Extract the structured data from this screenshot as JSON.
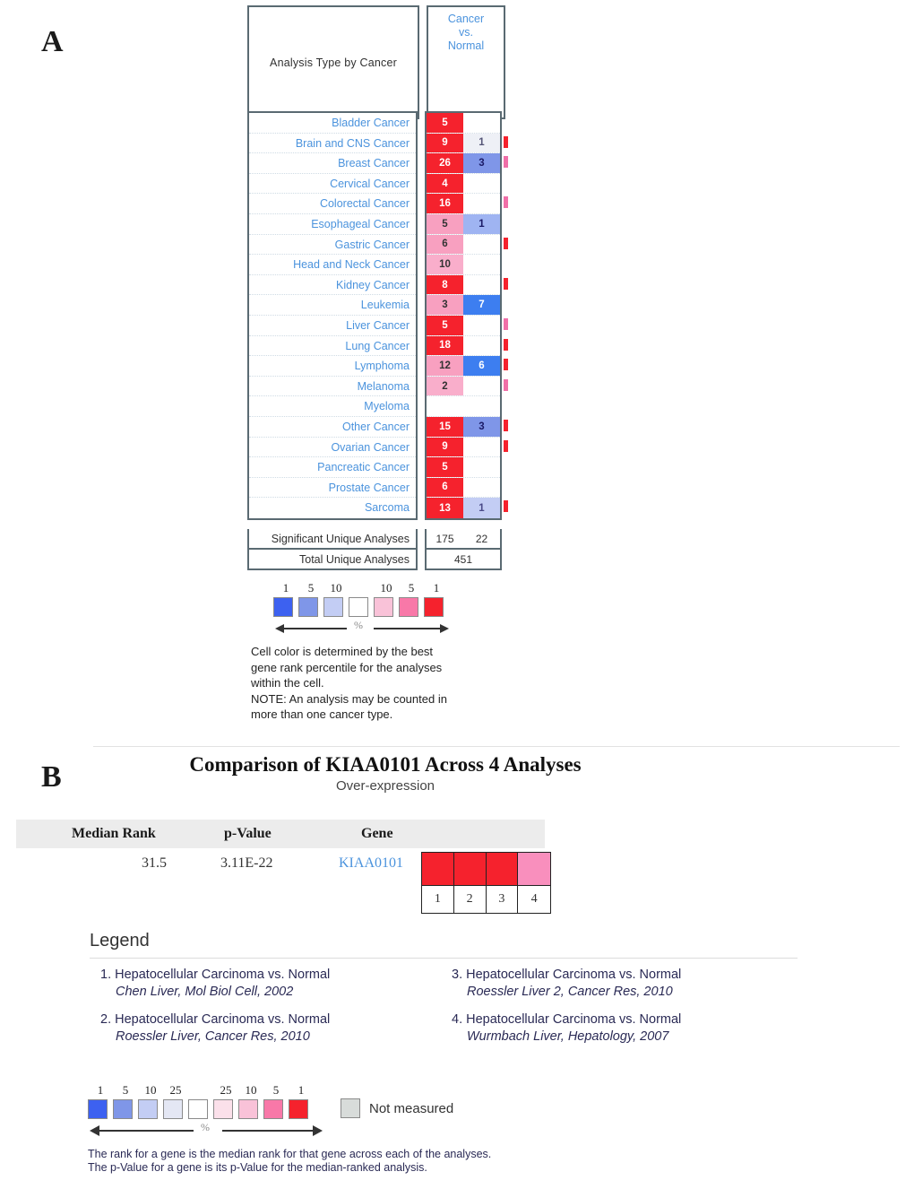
{
  "panels": {
    "a_letter": "A",
    "b_letter": "B"
  },
  "panelA": {
    "header": {
      "left": "Analysis Type by Cancer",
      "right_line1": "Cancer",
      "right_line2": "vs.",
      "right_line3": "Normal"
    },
    "rows": [
      {
        "name": "Bladder Cancer",
        "over": "5",
        "under": "",
        "over_color": "#f5222d",
        "over_text": "#ffffff",
        "under_color": "#ffffff",
        "under_text": "#333366",
        "strip_over": "",
        "strip_under": ""
      },
      {
        "name": "Brain and CNS Cancer",
        "over": "9",
        "under": "1",
        "over_color": "#f5222d",
        "over_text": "#ffffff",
        "under_color": "#eef0f6",
        "under_text": "#555577",
        "strip_over": "#f5222d",
        "strip_under": ""
      },
      {
        "name": "Breast Cancer",
        "over": "26",
        "under": "3",
        "over_color": "#f5222d",
        "over_text": "#ffffff",
        "under_color": "#7f96e8",
        "under_text": "#1a1a66",
        "strip_over": "#f06fa8",
        "strip_under": ""
      },
      {
        "name": "Cervical Cancer",
        "over": "4",
        "under": "",
        "over_color": "#f5222d",
        "over_text": "#ffffff",
        "under_color": "#ffffff",
        "under_text": "#333366",
        "strip_over": "",
        "strip_under": ""
      },
      {
        "name": "Colorectal Cancer",
        "over": "16",
        "under": "",
        "over_color": "#f5222d",
        "over_text": "#ffffff",
        "under_color": "#ffffff",
        "under_text": "#333366",
        "strip_over": "#f06fa8",
        "strip_under": ""
      },
      {
        "name": "Esophageal Cancer",
        "over": "5",
        "under": "1",
        "over_color": "#f8a0c0",
        "over_text": "#333333",
        "under_color": "#9fb4f2",
        "under_text": "#1a1a66",
        "strip_over": "",
        "strip_under": ""
      },
      {
        "name": "Gastric Cancer",
        "over": "6",
        "under": "",
        "over_color": "#f8a0c0",
        "over_text": "#333333",
        "under_color": "#ffffff",
        "under_text": "#333366",
        "strip_over": "#f5222d",
        "strip_under": ""
      },
      {
        "name": "Head and Neck Cancer",
        "over": "10",
        "under": "",
        "over_color": "#f9aecb",
        "over_text": "#333333",
        "under_color": "#ffffff",
        "under_text": "#333366",
        "strip_over": "",
        "strip_under": ""
      },
      {
        "name": "Kidney Cancer",
        "over": "8",
        "under": "",
        "over_color": "#f5222d",
        "over_text": "#ffffff",
        "under_color": "#ffffff",
        "under_text": "#333366",
        "strip_over": "#f5222d",
        "strip_under": ""
      },
      {
        "name": "Leukemia",
        "over": "3",
        "under": "7",
        "over_color": "#f8a0c0",
        "over_text": "#333333",
        "under_color": "#3d7ef0",
        "under_text": "#ffffff",
        "strip_over": "",
        "strip_under": ""
      },
      {
        "name": "Liver Cancer",
        "over": "5",
        "under": "",
        "over_color": "#f5222d",
        "over_text": "#ffffff",
        "under_color": "#ffffff",
        "under_text": "#333366",
        "strip_over": "#f06fa8",
        "strip_under": ""
      },
      {
        "name": "Lung Cancer",
        "over": "18",
        "under": "",
        "over_color": "#f5222d",
        "over_text": "#ffffff",
        "under_color": "#ffffff",
        "under_text": "#333366",
        "strip_over": "#f5222d",
        "strip_under": ""
      },
      {
        "name": "Lymphoma",
        "over": "12",
        "under": "6",
        "over_color": "#f8a0c0",
        "over_text": "#333333",
        "under_color": "#3d7ef0",
        "under_text": "#ffffff",
        "strip_over": "#f5222d",
        "strip_under": ""
      },
      {
        "name": "Melanoma",
        "over": "2",
        "under": "",
        "over_color": "#f9aecb",
        "over_text": "#333333",
        "under_color": "#ffffff",
        "under_text": "#333366",
        "strip_over": "#f06fa8",
        "strip_under": ""
      },
      {
        "name": "Myeloma",
        "over": "",
        "under": "",
        "over_color": "#ffffff",
        "over_text": "#333333",
        "under_color": "#ffffff",
        "under_text": "#333366",
        "strip_over": "",
        "strip_under": ""
      },
      {
        "name": "Other Cancer",
        "over": "15",
        "under": "3",
        "over_color": "#f5222d",
        "over_text": "#ffffff",
        "under_color": "#7f96e8",
        "under_text": "#1a1a66",
        "strip_over": "#f5222d",
        "strip_under": ""
      },
      {
        "name": "Ovarian Cancer",
        "over": "9",
        "under": "",
        "over_color": "#f5222d",
        "over_text": "#ffffff",
        "under_color": "#ffffff",
        "under_text": "#333366",
        "strip_over": "#f5222d",
        "strip_under": ""
      },
      {
        "name": "Pancreatic Cancer",
        "over": "5",
        "under": "",
        "over_color": "#f5222d",
        "over_text": "#ffffff",
        "under_color": "#ffffff",
        "under_text": "#333366",
        "strip_over": "",
        "strip_under": ""
      },
      {
        "name": "Prostate Cancer",
        "over": "6",
        "under": "",
        "over_color": "#f5222d",
        "over_text": "#ffffff",
        "under_color": "#ffffff",
        "under_text": "#333366",
        "strip_over": "",
        "strip_under": ""
      },
      {
        "name": "Sarcoma",
        "over": "13",
        "under": "1",
        "over_color": "#f5222d",
        "over_text": "#ffffff",
        "under_color": "#c3cdf4",
        "under_text": "#4a4a88",
        "strip_over": "#f5222d",
        "strip_under": ""
      }
    ],
    "summary": {
      "significant_label": "Significant Unique Analyses",
      "significant_over": "175",
      "significant_under": "22",
      "total_label": "Total Unique Analyses",
      "total_value": "451"
    },
    "legend": {
      "numbers": [
        "1",
        "5",
        "10",
        "",
        "10",
        "5",
        "1"
      ],
      "swatches": [
        "#3d61f0",
        "#7f96e8",
        "#c3cdf4",
        "#ffffff",
        "#f9c2d8",
        "#f878a8",
        "#f5222d"
      ],
      "percent_label": "%"
    },
    "caption": [
      "Cell color is determined by the best",
      "gene rank percentile for the analyses",
      "within the cell.",
      "NOTE: An analysis may be counted in",
      "more than one cancer type."
    ]
  },
  "panelB": {
    "title": "Comparison of KIAA0101 Across 4 Analyses",
    "subtitle": "Over-expression",
    "table": {
      "headers": {
        "rank": "Median Rank",
        "pvalue": "p-Value",
        "gene": "Gene"
      },
      "row": {
        "rank": "31.5",
        "pvalue": "3.11E-22",
        "gene": "KIAA0101"
      },
      "heat_colors": [
        "#f5222d",
        "#f5222d",
        "#f5222d",
        "#f98fbd"
      ],
      "heat_labels": [
        "1",
        "2",
        "3",
        "4"
      ]
    },
    "legend_title": "Legend",
    "legend_items": [
      {
        "num": "1.",
        "title": "Hepatocellular Carcinoma vs. Normal",
        "source": "Chen Liver, Mol Biol Cell, 2002"
      },
      {
        "num": "2.",
        "title": "Hepatocellular Carcinoma vs. Normal",
        "source": "Roessler Liver, Cancer Res, 2010"
      },
      {
        "num": "3.",
        "title": "Hepatocellular Carcinoma vs. Normal",
        "source": "Roessler Liver 2, Cancer Res, 2010"
      },
      {
        "num": "4.",
        "title": "Hepatocellular Carcinoma vs. Normal",
        "source": "Wurmbach Liver, Hepatology, 2007"
      }
    ],
    "scale": {
      "numbers": [
        "1",
        "5",
        "10",
        "25",
        "",
        "25",
        "10",
        "5",
        "1"
      ],
      "swatches": [
        "#3d61f0",
        "#7f96e8",
        "#c3cdf4",
        "#e4e7f4",
        "#ffffff",
        "#fbe0ea",
        "#f9c2d8",
        "#f878a8",
        "#f5222d"
      ],
      "percent_label": "%",
      "not_measured_label": "Not measured",
      "not_measured_color": "#d8dcda"
    },
    "footer": [
      "The rank for a gene is the median rank for that gene across each of the analyses.",
      "The p-Value for a gene is its p-Value for the median-ranked analysis."
    ]
  }
}
